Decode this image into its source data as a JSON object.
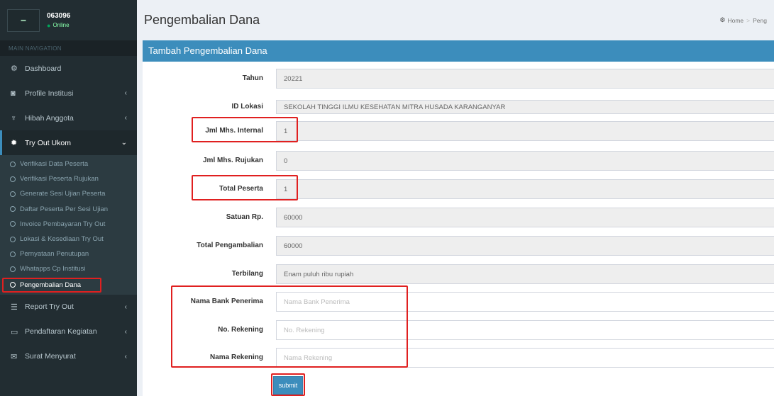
{
  "user": {
    "name": "063096",
    "status": "Online",
    "avatar_text": "logo"
  },
  "sidebar": {
    "header": "MAIN NAVIGATION",
    "items": [
      {
        "label": "Dashboard",
        "icon": "dashboard-icon"
      },
      {
        "label": "Profile Institusi",
        "icon": "camera-icon"
      },
      {
        "label": "Hibah Anggota",
        "icon": "trophy-icon"
      },
      {
        "label": "Try Out Ukom",
        "icon": "gear-icon"
      }
    ],
    "submenu": [
      "Verifikasi Data Peserta",
      "Verifikasi Peserta Rujukan",
      "Generate Sesi Ujian Peserta",
      "Daftar Peserta Per Sesi Ujian",
      "Invoice Pembayaran Try Out",
      "Lokasi & Kesediaan Try Out",
      "Pernyataan Penutupan",
      "Whatapps Cp Institusi",
      "Pengembalian Dana"
    ],
    "items_after": [
      {
        "label": "Report Try Out",
        "icon": "list-icon"
      },
      {
        "label": "Pendaftaran Kegiatan",
        "icon": "calendar-icon"
      },
      {
        "label": "Surat Menyurat",
        "icon": "envelope-icon"
      }
    ]
  },
  "page": {
    "title": "Pengembalian Dana",
    "breadcrumb": {
      "home": "Home",
      "current": "Peng"
    }
  },
  "form": {
    "title": "Tambah Pengembalian Dana",
    "fields": {
      "tahun": {
        "label": "Tahun",
        "value": "20221"
      },
      "id_lokasi": {
        "label": "ID Lokasi",
        "value": "SEKOLAH TINGGI ILMU KESEHATAN MITRA HUSADA KARANGANYAR"
      },
      "jml_internal": {
        "label": "Jml Mhs. Internal",
        "value": "1"
      },
      "jml_rujukan": {
        "label": "Jml Mhs. Rujukan",
        "value": "0"
      },
      "total_peserta": {
        "label": "Total Peserta",
        "value": "1"
      },
      "satuan": {
        "label": "Satuan Rp.",
        "value": "60000"
      },
      "total_pengambalian": {
        "label": "Total Pengambalian",
        "value": "60000"
      },
      "terbilang": {
        "label": "Terbilang",
        "value": "Enam puluh ribu rupiah"
      },
      "nama_bank": {
        "label": "Nama Bank Penerima",
        "placeholder": "Nama Bank Penerima"
      },
      "no_rekening": {
        "label": "No. Rekening",
        "placeholder": "No. Rekening"
      },
      "nama_rekening": {
        "label": "Nama Rekening",
        "placeholder": "Nama Rekening"
      }
    },
    "submit_label": "submit"
  },
  "colors": {
    "accent": "#3c8dbc",
    "sidebar": "#222d32",
    "highlight": "#e02020"
  }
}
